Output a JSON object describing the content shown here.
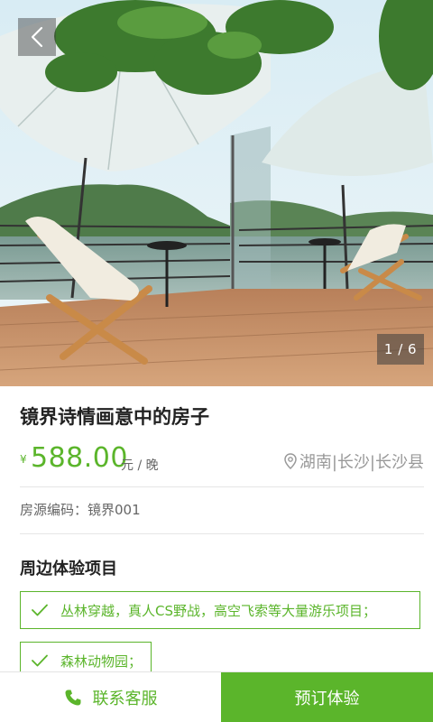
{
  "gallery": {
    "counter": "1 / 6",
    "image": "photo of a wooden terrace with umbrellas and chairs overlooking a lake and hills"
  },
  "listing": {
    "title": "镜界诗情画意中的房子",
    "currency": "¥",
    "price": "588.00",
    "unit": "元 / 晚",
    "location": "湖南|长沙|长沙县",
    "code": "房源编码：镜界001"
  },
  "experience": {
    "title": "周边体验项目",
    "items": [
      "丛林穿越，真人CS野战，高空飞索等大量游乐项目；",
      "森林动物园；"
    ]
  },
  "bottom": {
    "contact_label": "联系客服",
    "book_label": "预订体验"
  },
  "colors": {
    "accent": "#5bb52b",
    "muted": "#999999"
  },
  "icons": {
    "back": "chevron-left-icon",
    "location": "location-pin-icon",
    "check": "check-icon",
    "phone": "phone-icon"
  }
}
